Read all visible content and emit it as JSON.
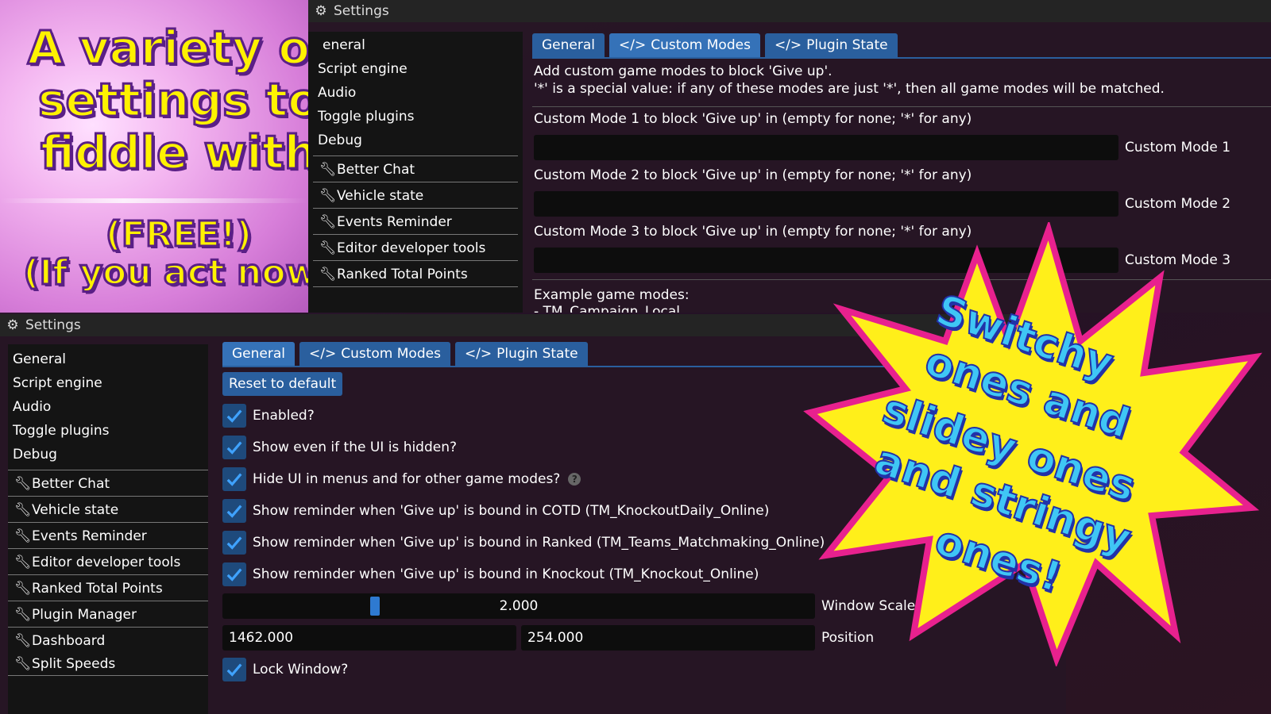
{
  "promo": {
    "line1": "A variety of",
    "line2": "settings to",
    "line3": "fiddle with",
    "line4": "(FREE!)",
    "line5": "(If you act now)"
  },
  "top_window": {
    "title": "Settings",
    "sidebar": {
      "items": [
        "eneral",
        "Script engine",
        "Audio",
        "Toggle plugins",
        "Debug"
      ],
      "tools": [
        "Better Chat",
        "Vehicle state",
        "Events Reminder",
        "Editor developer tools",
        "Ranked Total Points"
      ]
    },
    "tabs": [
      "General",
      "Custom Modes",
      "Plugin State"
    ],
    "active_tab": "Custom Modes",
    "intro_line1": "Add custom game modes to block 'Give up'.",
    "intro_line2": "'*' is a special value: if any of these modes are just '*', then all game modes will be matched.",
    "modes": [
      {
        "label": "Custom Mode 1 to block 'Give up' in (empty for none; '*' for any)",
        "field_label": "Custom Mode 1",
        "value": ""
      },
      {
        "label": "Custom Mode 2 to block 'Give up' in (empty for none; '*' for any)",
        "field_label": "Custom Mode 2",
        "value": ""
      },
      {
        "label": "Custom Mode 3 to block 'Give up' in (empty for none; '*' for any)",
        "field_label": "Custom Mode 3",
        "value": ""
      }
    ],
    "example_heading": "Example game modes:",
    "example_first": "- TM_Campaign_Local"
  },
  "bottom_window": {
    "title": "Settings",
    "sidebar": {
      "items": [
        "General",
        "Script engine",
        "Audio",
        "Toggle plugins",
        "Debug"
      ],
      "tools": [
        "Better Chat",
        "Vehicle state",
        "Events Reminder",
        "Editor developer tools",
        "Ranked Total Points",
        "Plugin Manager",
        "Dashboard",
        "Split Speeds"
      ]
    },
    "tabs": [
      "General",
      "Custom Modes",
      "Plugin State"
    ],
    "active_tab": "General",
    "reset_button": "Reset to default",
    "checkboxes": [
      {
        "label": "Enabled?",
        "checked": true
      },
      {
        "label": "Show even if the UI is hidden?",
        "checked": true
      },
      {
        "label": "Hide UI in menus and for other game modes?",
        "checked": true,
        "help": "?"
      },
      {
        "label": "Show reminder when 'Give up' is bound in COTD (TM_KnockoutDaily_Online)",
        "checked": true
      },
      {
        "label": "Show reminder when 'Give up' is bound in Ranked (TM_Teams_Matchmaking_Online)",
        "checked": true
      },
      {
        "label": "Show reminder when 'Give up' is bound in Knockout (TM_Knockout_Online)",
        "checked": true
      }
    ],
    "window_scale": {
      "value": "2.000",
      "label": "Window Scale",
      "fraction": 0.25
    },
    "position": {
      "x": "1462.000",
      "y": "254.000",
      "label": "Position"
    },
    "lock_window": {
      "label": "Lock Window?",
      "checked": true
    }
  },
  "starburst": {
    "line1": "Switchy",
    "line2": "ones and",
    "line3": "slidey ones",
    "line4": "and stringy",
    "line5": "ones!"
  },
  "colors": {
    "accent": "#2a5f9e",
    "promo_text": "#fff200",
    "burst_fill": "#ffef1a",
    "burst_stroke": "#e8218e",
    "burst_text": "#3fc6f5"
  }
}
